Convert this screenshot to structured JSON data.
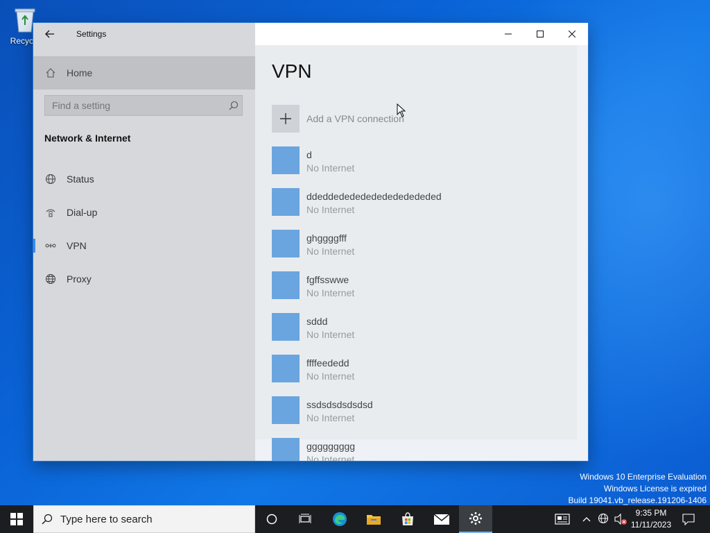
{
  "desktop": {
    "recycle_bin_label": "Recycle"
  },
  "window": {
    "title": "Settings",
    "controls": {
      "minimize": "—",
      "maximize": "☐",
      "close": "✕"
    }
  },
  "sidebar": {
    "home_label": "Home",
    "search_placeholder": "Find a setting",
    "section_heading": "Network & Internet",
    "items": [
      {
        "label": "Status",
        "icon": "globe-status-icon"
      },
      {
        "label": "Dial-up",
        "icon": "dial-up-icon"
      },
      {
        "label": "VPN",
        "icon": "vpn-icon",
        "selected": true
      },
      {
        "label": "Proxy",
        "icon": "globe-icon"
      }
    ]
  },
  "content": {
    "title": "VPN",
    "add_label": "Add a VPN connection",
    "connections": [
      {
        "name": "d",
        "status": "No Internet"
      },
      {
        "name": "ddeddedededededededededed",
        "status": "No Internet"
      },
      {
        "name": "ghggggfff",
        "status": "No Internet"
      },
      {
        "name": "fgffsswwe",
        "status": "No Internet"
      },
      {
        "name": "sddd",
        "status": "No Internet"
      },
      {
        "name": "ffffeededd",
        "status": "No Internet"
      },
      {
        "name": "ssdsdsdsdsdsd",
        "status": "No Internet"
      },
      {
        "name": "ggggggggg",
        "status": "No Internet"
      }
    ]
  },
  "watermark": {
    "line1": "Windows 10 Enterprise Evaluation",
    "line2": "Windows License is expired",
    "line3": "Build 19041.vb_release.191206-1406"
  },
  "taskbar": {
    "search_placeholder": "Type here to search",
    "apps": [
      "cortana-icon",
      "task-view-icon",
      "edge-icon",
      "file-explorer-icon",
      "store-icon",
      "mail-icon",
      "settings-icon"
    ],
    "time": "9:35 PM",
    "date": "11/11/2023"
  },
  "colors": {
    "accent": "#3a8ee6",
    "vpn_tile": "#6aa5e0",
    "taskbar": "#1b1d20"
  }
}
